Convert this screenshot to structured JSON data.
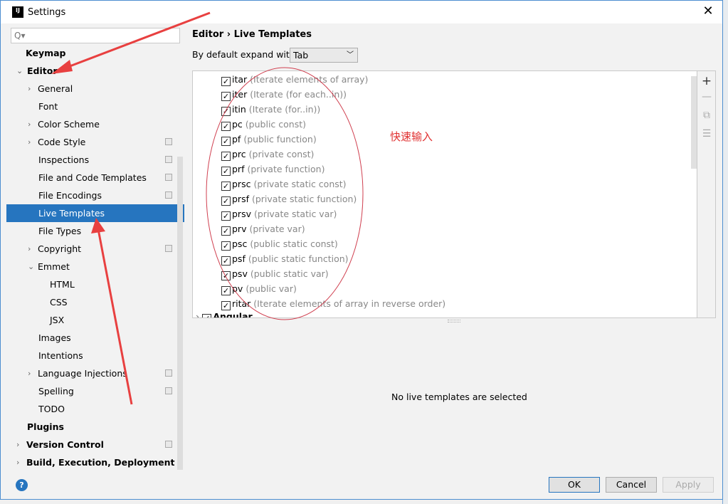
{
  "window": {
    "title": "Settings",
    "logo": "IJ"
  },
  "search": {
    "placeholder": "Q▾"
  },
  "sidebar": {
    "items": [
      {
        "label": "Keymap"
      },
      {
        "label": "Editor"
      },
      {
        "label": "General"
      },
      {
        "label": "Font"
      },
      {
        "label": "Color Scheme"
      },
      {
        "label": "Code Style"
      },
      {
        "label": "Inspections"
      },
      {
        "label": "File and Code Templates"
      },
      {
        "label": "File Encodings"
      },
      {
        "label": "Live Templates"
      },
      {
        "label": "File Types"
      },
      {
        "label": "Copyright"
      },
      {
        "label": "Emmet"
      },
      {
        "label": "HTML"
      },
      {
        "label": "CSS"
      },
      {
        "label": "JSX"
      },
      {
        "label": "Images"
      },
      {
        "label": "Intentions"
      },
      {
        "label": "Language Injections"
      },
      {
        "label": "Spelling"
      },
      {
        "label": "TODO"
      },
      {
        "label": "Plugins"
      },
      {
        "label": "Version Control"
      },
      {
        "label": "Build, Execution, Deployment"
      }
    ]
  },
  "breadcrumb": {
    "parent": "Editor",
    "current": "Live Templates"
  },
  "expand": {
    "label": "By default expand with",
    "value": "Tab"
  },
  "templates": [
    {
      "abbr": "itar",
      "desc": "(Iterate elements of array)"
    },
    {
      "abbr": "iter",
      "desc": "(Iterate (for each..in))"
    },
    {
      "abbr": "itin",
      "desc": "(Iterate (for..in))"
    },
    {
      "abbr": "pc",
      "desc": "(public const)"
    },
    {
      "abbr": "pf",
      "desc": "(public function)"
    },
    {
      "abbr": "prc",
      "desc": "(private const)"
    },
    {
      "abbr": "prf",
      "desc": "(private function)"
    },
    {
      "abbr": "prsc",
      "desc": "(private static const)"
    },
    {
      "abbr": "prsf",
      "desc": "(private static function)"
    },
    {
      "abbr": "prsv",
      "desc": "(private static var)"
    },
    {
      "abbr": "prv",
      "desc": "(private var)"
    },
    {
      "abbr": "psc",
      "desc": "(public static const)"
    },
    {
      "abbr": "psf",
      "desc": "(public static function)"
    },
    {
      "abbr": "psv",
      "desc": "(public static var)"
    },
    {
      "abbr": "pv",
      "desc": "(public var)"
    },
    {
      "abbr": "ritar",
      "desc": "(Iterate elements of array in reverse order)"
    }
  ],
  "group": {
    "label": "Angular"
  },
  "annotation": {
    "text": "快速输入",
    "color": "#e03030"
  },
  "empty_message": "No live templates are selected",
  "buttons": {
    "ok": "OK",
    "cancel": "Cancel",
    "apply": "Apply",
    "help": "?"
  },
  "accent": "#2675bf"
}
